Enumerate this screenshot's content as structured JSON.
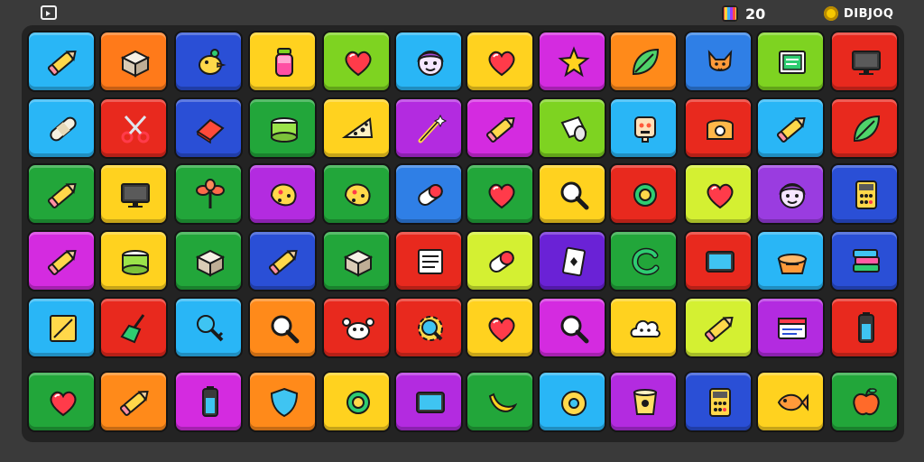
{
  "header": {
    "score": "20",
    "coins_label": "DIBJOQ"
  },
  "tiles": [
    [
      {
        "color": "#29b6f6",
        "icon": "pencil-icon"
      },
      {
        "color": "#ff7a1a",
        "icon": "box-icon"
      },
      {
        "color": "#2a4fd6",
        "icon": "bird-icon"
      },
      {
        "color": "#ffd21f",
        "icon": "potion-icon"
      },
      {
        "color": "#7ed321",
        "icon": "heart-icon"
      },
      {
        "color": "#29b6f6",
        "icon": "face-icon"
      },
      {
        "color": "#ffd21f",
        "icon": "heart-icon"
      },
      {
        "color": "#d42be0",
        "icon": "star-icon"
      },
      {
        "color": "#ff8a1a",
        "icon": "leaf-icon"
      },
      {
        "color": "#2f7fe6",
        "icon": "fox-icon"
      },
      {
        "color": "#7ed321",
        "icon": "book-icon"
      },
      {
        "color": "#e8291e",
        "icon": "monitor-icon"
      }
    ],
    [
      {
        "color": "#29b6f6",
        "icon": "bandage-icon"
      },
      {
        "color": "#e8291e",
        "icon": "scissors-icon"
      },
      {
        "color": "#2a4fd6",
        "icon": "eraser-icon"
      },
      {
        "color": "#22a63a",
        "icon": "cake-icon"
      },
      {
        "color": "#ffd21f",
        "icon": "cheese-icon"
      },
      {
        "color": "#b32be0",
        "icon": "wand-icon"
      },
      {
        "color": "#d42be0",
        "icon": "pencil-icon"
      },
      {
        "color": "#7ed321",
        "icon": "roll-icon"
      },
      {
        "color": "#29b6f6",
        "icon": "robot-icon"
      },
      {
        "color": "#e8291e",
        "icon": "phone-icon"
      },
      {
        "color": "#29b6f6",
        "icon": "pencil-icon"
      },
      {
        "color": "#e8291e",
        "icon": "leaf-icon"
      }
    ],
    [
      {
        "color": "#22a63a",
        "icon": "pencil-icon"
      },
      {
        "color": "#ffd21f",
        "icon": "monitor-icon"
      },
      {
        "color": "#22a63a",
        "icon": "plant-icon"
      },
      {
        "color": "#b32be0",
        "icon": "cookie-icon"
      },
      {
        "color": "#22a63a",
        "icon": "cookie-icon"
      },
      {
        "color": "#2f7fe6",
        "icon": "pill-icon"
      },
      {
        "color": "#22a63a",
        "icon": "heart-icon"
      },
      {
        "color": "#ffd21f",
        "icon": "search-icon"
      },
      {
        "color": "#e8291e",
        "icon": "ring-icon"
      },
      {
        "color": "#d4f032",
        "icon": "heart-icon"
      },
      {
        "color": "#9a3ce0",
        "icon": "face-icon"
      },
      {
        "color": "#2a4fd6",
        "icon": "calculator-icon"
      }
    ],
    [
      {
        "color": "#d42be0",
        "icon": "pencil-icon"
      },
      {
        "color": "#ffd21f",
        "icon": "cake-icon"
      },
      {
        "color": "#22a63a",
        "icon": "box-icon"
      },
      {
        "color": "#2a4fd6",
        "icon": "pencil-icon"
      },
      {
        "color": "#22a63a",
        "icon": "box-icon"
      },
      {
        "color": "#e8291e",
        "icon": "notepad-icon"
      },
      {
        "color": "#d4f032",
        "icon": "pill-icon"
      },
      {
        "color": "#6a22d6",
        "icon": "card-icon"
      },
      {
        "color": "#22a63a",
        "icon": "letter-c-icon"
      },
      {
        "color": "#e8291e",
        "icon": "tablet-icon"
      },
      {
        "color": "#29b6f6",
        "icon": "basket-icon"
      },
      {
        "color": "#2a4fd6",
        "icon": "books-icon"
      }
    ],
    [
      {
        "color": "#29b6f6",
        "icon": "note-icon"
      },
      {
        "color": "#e8291e",
        "icon": "broom-icon"
      },
      {
        "color": "#29b6f6",
        "icon": "key-icon"
      },
      {
        "color": "#ff8a1a",
        "icon": "search-icon"
      },
      {
        "color": "#e8291e",
        "icon": "crab-icon"
      },
      {
        "color": "#e8291e",
        "icon": "gear-icon"
      },
      {
        "color": "#ffd21f",
        "icon": "heart-icon"
      },
      {
        "color": "#d42be0",
        "icon": "search-icon"
      },
      {
        "color": "#ffd21f",
        "icon": "cloud-icon"
      },
      {
        "color": "#d4f032",
        "icon": "pencil-icon"
      },
      {
        "color": "#b32be0",
        "icon": "window-icon"
      },
      {
        "color": "#e8291e",
        "icon": "battery-icon"
      }
    ],
    [
      {
        "color": "#22a63a",
        "icon": "heart-icon"
      },
      {
        "color": "#ff8a1a",
        "icon": "pencil-icon"
      },
      {
        "color": "#d42be0",
        "icon": "battery-icon"
      },
      {
        "color": "#ff8a1a",
        "icon": "shield-icon"
      },
      {
        "color": "#ffd21f",
        "icon": "ring-icon"
      },
      {
        "color": "#b32be0",
        "icon": "tablet-icon"
      },
      {
        "color": "#22a63a",
        "icon": "banana-icon"
      },
      {
        "color": "#29b6f6",
        "icon": "tape-icon"
      },
      {
        "color": "#b32be0",
        "icon": "cup-icon"
      },
      {
        "color": "#2a4fd6",
        "icon": "calculator-icon"
      },
      {
        "color": "#ffd21f",
        "icon": "fish-icon"
      },
      {
        "color": "#22a63a",
        "icon": "apple-icon"
      }
    ]
  ]
}
